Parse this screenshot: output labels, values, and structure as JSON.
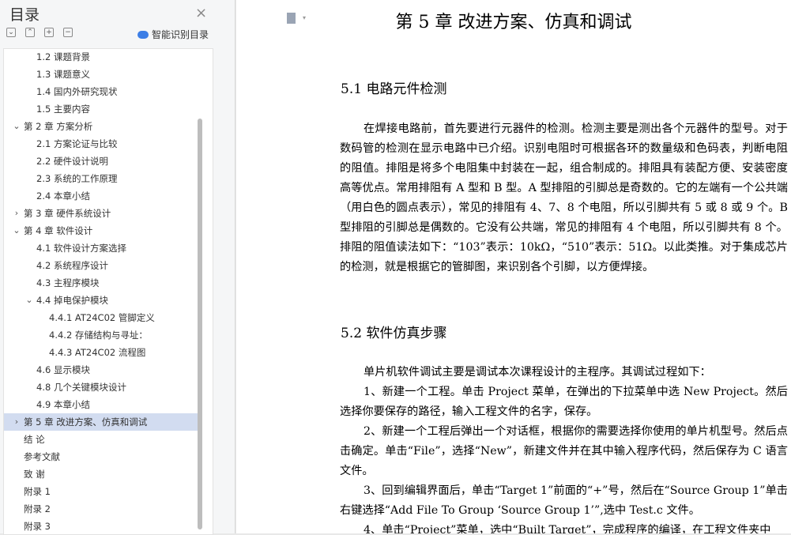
{
  "sidebar": {
    "title": "目录",
    "close": "×",
    "toolbar": {
      "collapse": "⌄",
      "expand": "⌃",
      "add": "+",
      "remove": "−"
    },
    "smart_label": "智能识别目录",
    "items": [
      {
        "text": "1.2  课题背景",
        "level": 2,
        "arrow": ""
      },
      {
        "text": "1.3  课题意义",
        "level": 2,
        "arrow": ""
      },
      {
        "text": "1.4  国内外研究现状",
        "level": 2,
        "arrow": ""
      },
      {
        "text": "1.5  主要内容",
        "level": 2,
        "arrow": ""
      },
      {
        "text": "第 2 章  方案分析",
        "level": 1,
        "arrow": "⌄"
      },
      {
        "text": "2.1  方案论证与比较",
        "level": 2,
        "arrow": ""
      },
      {
        "text": "2.2  硬件设计说明",
        "level": 2,
        "arrow": ""
      },
      {
        "text": "2.3  系统的工作原理",
        "level": 2,
        "arrow": ""
      },
      {
        "text": "2.4  本章小结",
        "level": 2,
        "arrow": ""
      },
      {
        "text": "第 3 章  硬件系统设计",
        "level": 1,
        "arrow": "›"
      },
      {
        "text": "第 4 章  软件设计",
        "level": 1,
        "arrow": "⌄"
      },
      {
        "text": "4.1  软件设计方案选择",
        "level": 2,
        "arrow": ""
      },
      {
        "text": "4.2  系统程序设计",
        "level": 2,
        "arrow": ""
      },
      {
        "text": "4.3  主程序模块",
        "level": 2,
        "arrow": ""
      },
      {
        "text": "4.4  掉电保护模块",
        "level": 2,
        "arrow": "⌄"
      },
      {
        "text": "4.4.1 AT24C02 管脚定义",
        "level": 3,
        "arrow": ""
      },
      {
        "text": "4.4.2  存储结构与寻址：",
        "level": 3,
        "arrow": ""
      },
      {
        "text": "4.4.3 AT24C02 流程图",
        "level": 3,
        "arrow": ""
      },
      {
        "text": "4.6  显示模块",
        "level": 2,
        "arrow": ""
      },
      {
        "text": "4.8  几个关键模块设计",
        "level": 2,
        "arrow": ""
      },
      {
        "text": "4.9 本章小结",
        "level": 2,
        "arrow": ""
      },
      {
        "text": "第 5 章  改进方案、仿真和调试",
        "level": 1,
        "arrow": "›",
        "active": true
      },
      {
        "text": "结  论",
        "level": 1,
        "arrow": ""
      },
      {
        "text": "参考文献",
        "level": 1,
        "arrow": ""
      },
      {
        "text": "致  谢",
        "level": 1,
        "arrow": ""
      },
      {
        "text": "附录 1",
        "level": 1,
        "arrow": ""
      },
      {
        "text": "附录 2",
        "level": 1,
        "arrow": ""
      },
      {
        "text": "附录 3",
        "level": 1,
        "arrow": ""
      }
    ]
  },
  "document": {
    "chapter_title": "第 5 章  改进方案、仿真和调试",
    "sec1_title": "5.1  电路元件检测",
    "sec1_para": "在焊接电路前，首先要进行元器件的检测。检测主要是测出各个元器件的型号。对于数码管的检测在显示电路中已介绍。识别电阻时可根据各环的数量级和色码表，判断电阻的阻值。排阻是将多个电阻集中封装在一起，组合制成的。排阻具有装配方便、安装密度高等优点。常用排阻有 A 型和 B 型。A 型排阻的引脚总是奇数的。它的左端有一个公共端（用白色的圆点表示），常见的排阻有 4、7、8 个电阻，所以引脚共有 5 或 8 或 9 个。B 型排阻的引脚总是偶数的。它没有公共端，常见的排阻有 4 个电阻，所以引脚共有 8 个。排阻的阻值读法如下：“103”表示：10kΩ，“510”表示：51Ω。以此类推。对于集成芯片的检测，就是根据它的管脚图，来识别各个引脚，以方便焊接。",
    "sec2_title": "5.2  软件仿真步骤",
    "sec2_intro": "单片机软件调试主要是调试本次课程设计的主程序。其调试过程如下：",
    "step1": "1、新建一个工程。单击 Project 菜单，在弹出的下拉菜单中选 New Project。然后选择你要保存的路径，输入工程文件的名字，保存。",
    "step2": "2、新建一个工程后弹出一个对话框，根据你的需要选择你使用的单片机型号。然后点击确定。单击“File”，选择“New”，新建文件并在其中输入程序代码，然后保存为 C 语言文件。",
    "step3": "3、回到编辑界面后，单击“Target 1”前面的“+”号，然后在“Source Group 1”单击右键选择“Add File To Group ‘Source Group 1’”,选中 Test.c 文件。",
    "step4": "4、单击“Project”菜单，选中“Built Target”，完成程序的编译，在工程文件夹中"
  }
}
